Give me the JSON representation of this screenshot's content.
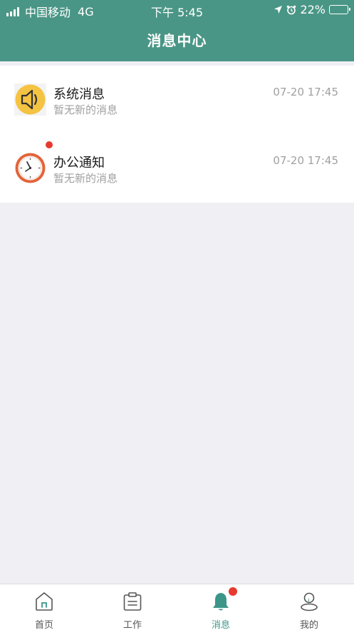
{
  "status_bar": {
    "carrier": "中国移动",
    "network": "4G",
    "time": "下午 5:45",
    "battery": "22%",
    "battery_level": 0.22
  },
  "nav": {
    "title": "消息中心"
  },
  "messages": [
    {
      "title": "系统消息",
      "subtitle": "暂无新的消息",
      "time": "07-20 17:45",
      "icon": "speaker-icon",
      "unread": false
    },
    {
      "title": "办公通知",
      "subtitle": "暂无新的消息",
      "time": "07-20 17:45",
      "icon": "clock-icon",
      "unread": true
    }
  ],
  "tabs": [
    {
      "label": "首页",
      "icon": "home-icon",
      "active": false
    },
    {
      "label": "工作",
      "icon": "clipboard-icon",
      "active": false
    },
    {
      "label": "消息",
      "icon": "bell-icon",
      "active": true,
      "badge": true
    },
    {
      "label": "我的",
      "icon": "user-icon",
      "active": false
    }
  ],
  "colors": {
    "primary": "#4a9686",
    "badge": "#e8392e",
    "speaker_bg": "#f5c342",
    "clock_ring": "#e2643a"
  }
}
